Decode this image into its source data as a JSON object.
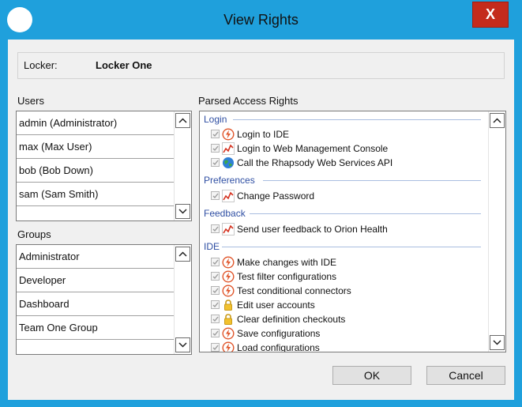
{
  "window": {
    "title": "View Rights",
    "close_label": "X"
  },
  "locker": {
    "label": "Locker:",
    "value": "Locker One"
  },
  "users": {
    "label": "Users",
    "items": [
      "admin (Administrator)",
      "max (Max User)",
      "bob (Bob Down)",
      "sam (Sam Smith)"
    ]
  },
  "groups": {
    "label": "Groups",
    "items": [
      "Administrator",
      "Developer",
      "Dashboard",
      "Team One Group"
    ]
  },
  "rights": {
    "label": "Parsed Access Rights",
    "categories": [
      {
        "name": "Login",
        "items": [
          {
            "text": "Login to IDE",
            "icon": "lightning-icon"
          },
          {
            "text": "Login to Web Management Console",
            "icon": "chart-icon"
          },
          {
            "text": "Call the Rhapsody Web Services API",
            "icon": "globe-icon"
          }
        ]
      },
      {
        "name": "Preferences",
        "items": [
          {
            "text": "Change Password",
            "icon": "chart-icon"
          }
        ]
      },
      {
        "name": "Feedback",
        "items": [
          {
            "text": "Send user feedback to Orion Health",
            "icon": "chart-icon"
          }
        ]
      },
      {
        "name": "IDE",
        "items": [
          {
            "text": "Make changes with IDE",
            "icon": "lightning-icon"
          },
          {
            "text": "Test filter configurations",
            "icon": "lightning-icon"
          },
          {
            "text": "Test conditional connectors",
            "icon": "lightning-icon"
          },
          {
            "text": "Edit user accounts",
            "icon": "lock-icon"
          },
          {
            "text": "Clear definition checkouts",
            "icon": "lock-icon"
          },
          {
            "text": "Save configurations",
            "icon": "lightning-icon"
          },
          {
            "text": "Load configurations",
            "icon": "lightning-icon"
          }
        ]
      }
    ]
  },
  "buttons": {
    "ok": "OK",
    "cancel": "Cancel"
  }
}
